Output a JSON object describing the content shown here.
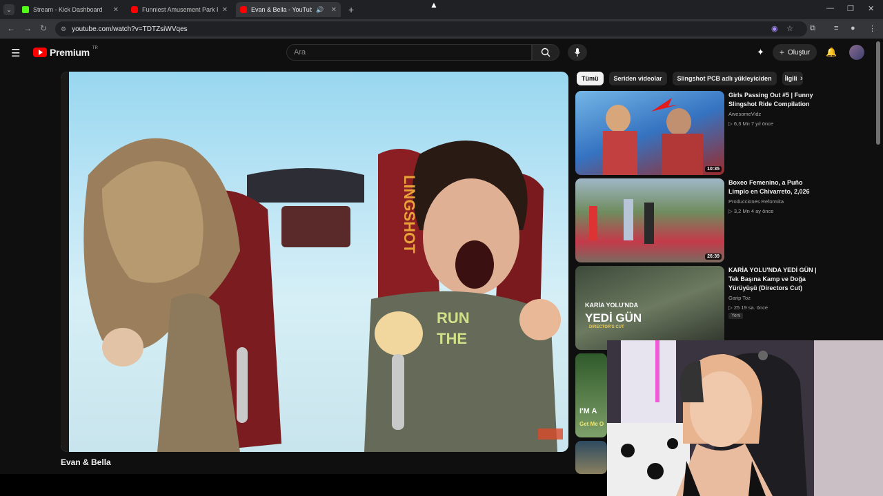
{
  "browser": {
    "tabs": [
      {
        "title": "Stream - Kick Dashboard",
        "favicon": "kick-icon"
      },
      {
        "title": "Funniest Amusement Park Fails",
        "favicon": "youtube-icon"
      },
      {
        "title": "Evan & Bella - YouTube",
        "favicon": "youtube-icon",
        "active": true
      }
    ],
    "url": "youtube.com/watch?v=TDTZsiWVqes"
  },
  "youtube": {
    "logo_text": "Premium",
    "country_code": "TR",
    "search_placeholder": "Ara",
    "create_label": "Oluştur"
  },
  "video": {
    "title": "Evan & Bella",
    "seat_text": "LINGSHOT",
    "shirt_text_1": "RUN",
    "shirt_text_2": "THE"
  },
  "chips": [
    "Tümü",
    "Seriden videolar",
    "Slingshot PCB adlı yükleyiciden",
    "İlgili"
  ],
  "recommendations": [
    {
      "title": "Girls Passing Out #5 | Funny Slingshot Ride Compilation",
      "channel": "AwesomeVidz",
      "meta": "6,3 Mn  7 yıl önce",
      "duration": "10:35"
    },
    {
      "title": "Boxeo Femenino, a Puño Limpio en Chivarreto,  2,026",
      "channel": "Producciones Reformita",
      "meta": "3,2 Mn  4 ay önce",
      "duration": "26:39"
    },
    {
      "title": "KARİA YOLU'NDA YEDİ GÜN | Tek Başına Kamp ve Doğa Yürüyüşü (Directors Cut)",
      "channel": "Garip Toz",
      "meta": "25  19 sa. önce",
      "badge": "Yeni",
      "thumb_text_1": "KARİA YOLU'NDA",
      "thumb_text_2": "YEDİ GÜN",
      "thumb_text_3": "DIRECTOR'S CUT"
    },
    {
      "thumb_text_1": "I'M A",
      "thumb_text_2": "Get Me O"
    }
  ],
  "colors": {
    "youtube_red": "#ff0000",
    "kick_green": "#53fc18",
    "page_bg": "#0f0f0f"
  }
}
